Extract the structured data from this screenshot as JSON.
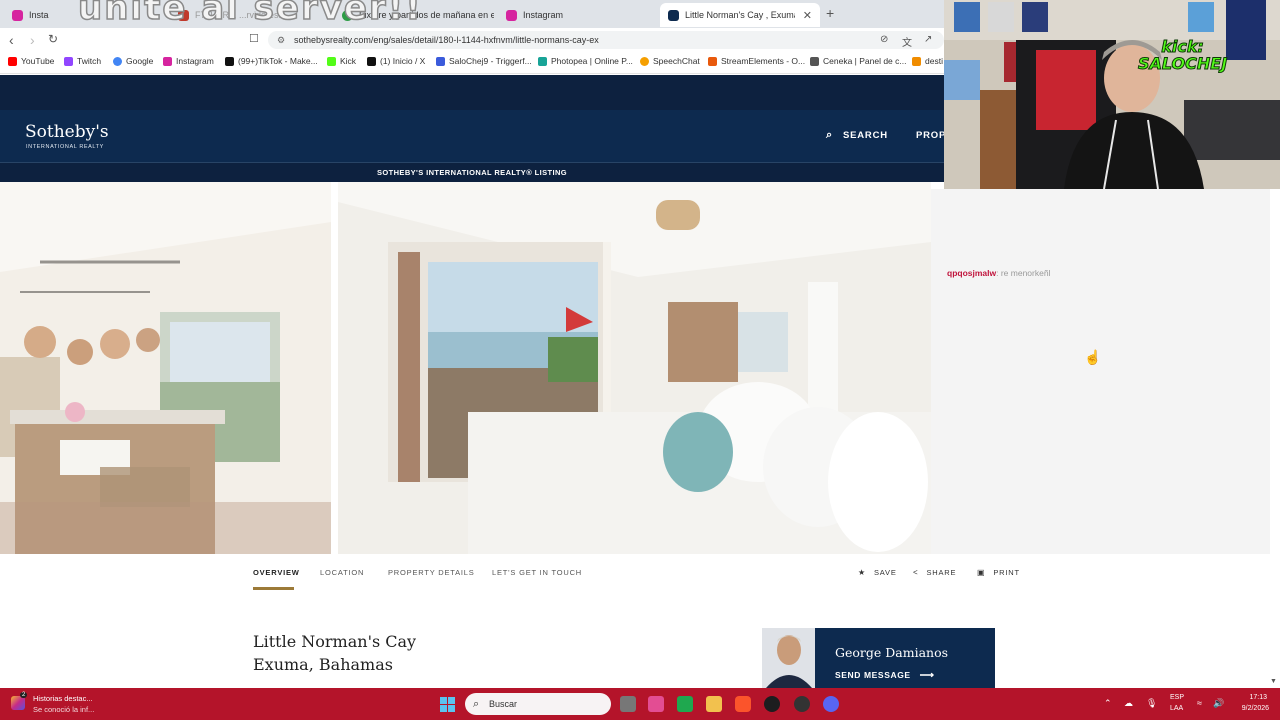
{
  "browser": {
    "overlay_text": "unite al server!!",
    "tabs": [
      {
        "label": "Insta",
        "color": "#d6249f"
      },
      {
        "label": "F7 J... R...  ...rvidores...",
        "color": "#c0392b"
      },
      {
        "label": "Fixture y partidos de mañana en el F...",
        "color": "#2e9c46"
      },
      {
        "label": "Instagram",
        "color": "#d6249f"
      },
      {
        "label": "Little Norman's Cay , Exuma, Bah",
        "color": "#0d2a4f"
      }
    ],
    "new_tab_symbol": "+",
    "url": "sothebysrealty.com/eng/sales/detail/180-l-1144-hxfnvm/little-normans-cay-ex",
    "bookmarks": [
      {
        "label": "YouTube",
        "color": "#ff0000"
      },
      {
        "label": "Twitch",
        "color": "#9146ff"
      },
      {
        "label": "Google",
        "color": "#4285f4"
      },
      {
        "label": "Instagram",
        "color": "#d6249f"
      },
      {
        "label": "(99+)TikTok - Make...",
        "color": "#111111"
      },
      {
        "label": "Kick",
        "color": "#53fc18"
      },
      {
        "label": "(1) Inicio / X",
        "color": "#111111"
      },
      {
        "label": "SaloChej9 - Triggerf...",
        "color": "#3b5bdb"
      },
      {
        "label": "Photopea | Online P...",
        "color": "#18a497"
      },
      {
        "label": "SpeechChat",
        "color": "#f59f00"
      },
      {
        "label": "StreamElements - O...",
        "color": "#e8590c"
      },
      {
        "label": "Ceneka | Panel de c...",
        "color": "#555555"
      },
      {
        "label": "desti",
        "color": "#f08c00"
      }
    ]
  },
  "site": {
    "logo": "Sotheby's",
    "logo_sub": "INTERNATIONAL REALTY",
    "search_label": "SEARCH",
    "prop_label": "PROP",
    "listing_banner": "SOTHEBY'S INTERNATIONAL REALTY® LISTING",
    "chat_user": "qpqosjmalw",
    "chat_message": ": re menorkeñl",
    "nav_tabs": [
      "OVERVIEW",
      "LOCATION",
      "PROPERTY DETAILS",
      "LET'S GET IN TOUCH"
    ],
    "actions": {
      "save": "SAVE",
      "share": "SHARE",
      "print": "PRINT"
    },
    "title_line1": "Little Norman's Cay",
    "title_line2": "Exuma, Bahamas",
    "agent_name": "George Damianos",
    "agent_cta": "SEND MESSAGE",
    "agent_cta_arrow": "⟶",
    "brand_color": "#0d2a4f",
    "accent_color": "#9c7a38"
  },
  "webcam": {
    "kick_line1": "kick:",
    "kick_line2": "SALOCHEJ",
    "kick_color": "#53fc18"
  },
  "taskbar": {
    "notif_title": "Historias destac...",
    "notif_sub": "Se conoció la inf...",
    "notif_count": "2",
    "search_placeholder": "Buscar",
    "lang1": "ESP",
    "lang2": "LAA",
    "time": "17:13",
    "date": "9/2/2026",
    "color": "#b4142a"
  }
}
